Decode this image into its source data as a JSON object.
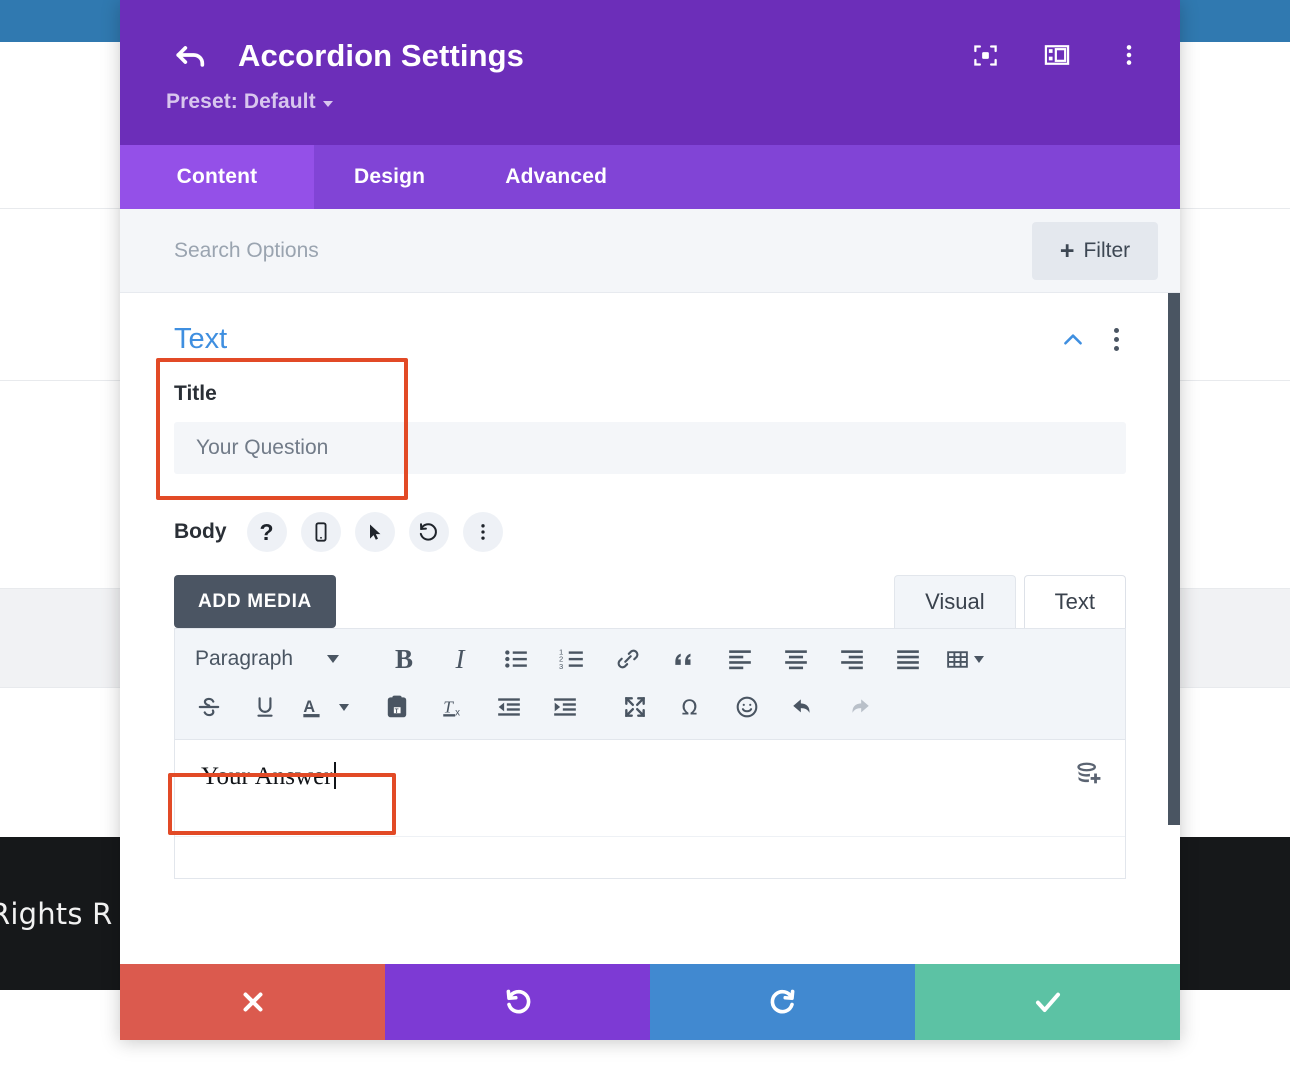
{
  "background": {
    "topbar_color": "#3079b0",
    "footer_text": "Rights R",
    "footer_color": "#16181a"
  },
  "modal": {
    "title": "Accordion Settings",
    "back_icon": "back-arrow-icon",
    "preset_label": "Preset: Default",
    "header_color": "#6c2eb9",
    "header_icons": [
      {
        "name": "focus-target-icon"
      },
      {
        "name": "layout-panel-icon"
      },
      {
        "name": "more-options-icon"
      }
    ],
    "tabs": [
      {
        "label": "Content",
        "active": true
      },
      {
        "label": "Design",
        "active": false
      },
      {
        "label": "Advanced",
        "active": false
      }
    ],
    "search": {
      "placeholder": "Search Options",
      "value": ""
    },
    "filter_button": {
      "label": "Filter",
      "icon": "plus-icon"
    },
    "section": {
      "title": "Text",
      "collapse_icon": "chevron-up-icon",
      "menu_icon": "kebab-menu-icon"
    },
    "title_field": {
      "label": "Title",
      "value": "Your Question",
      "placeholder": "Your Question",
      "highlight_color": "#e24a26"
    },
    "body_field": {
      "label": "Body",
      "tools": [
        {
          "name": "help-icon",
          "glyph": "?"
        },
        {
          "name": "responsive-mobile-icon"
        },
        {
          "name": "hover-cursor-icon"
        },
        {
          "name": "reset-undo-icon"
        },
        {
          "name": "more-options-icon"
        }
      ]
    },
    "editor": {
      "add_media_label": "ADD MEDIA",
      "mode_tabs": [
        {
          "label": "Visual",
          "active": true
        },
        {
          "label": "Text",
          "active": false
        }
      ],
      "format_select": "Paragraph",
      "toolbar_row1": [
        {
          "name": "bold-icon"
        },
        {
          "name": "italic-icon"
        },
        {
          "name": "bulleted-list-icon"
        },
        {
          "name": "numbered-list-icon"
        },
        {
          "name": "link-icon"
        },
        {
          "name": "blockquote-icon"
        },
        {
          "name": "align-left-icon"
        },
        {
          "name": "align-center-icon"
        },
        {
          "name": "align-right-icon"
        },
        {
          "name": "align-justify-icon"
        },
        {
          "name": "table-icon"
        }
      ],
      "toolbar_row2": [
        {
          "name": "strikethrough-icon"
        },
        {
          "name": "underline-icon"
        },
        {
          "name": "text-color-icon"
        },
        {
          "name": "paste-as-text-icon"
        },
        {
          "name": "clear-formatting-icon"
        },
        {
          "name": "decrease-indent-icon"
        },
        {
          "name": "increase-indent-icon"
        },
        {
          "name": "fullscreen-icon"
        },
        {
          "name": "special-character-icon"
        },
        {
          "name": "emoji-icon"
        },
        {
          "name": "undo-icon"
        },
        {
          "name": "redo-icon"
        }
      ],
      "content_text": "Your Answer",
      "dynamic_content_icon": "add-dynamic-content-icon",
      "highlight_color": "#e24a26"
    },
    "actions": [
      {
        "name": "cancel-button",
        "icon": "close-x-icon",
        "color": "#db5a4e"
      },
      {
        "name": "undo-button",
        "icon": "undo-arrow-icon",
        "color": "#7d3ad4"
      },
      {
        "name": "redo-button",
        "icon": "redo-arrow-icon",
        "color": "#4189d0"
      },
      {
        "name": "save-button",
        "icon": "checkmark-icon",
        "color": "#5cc2a4"
      }
    ]
  }
}
